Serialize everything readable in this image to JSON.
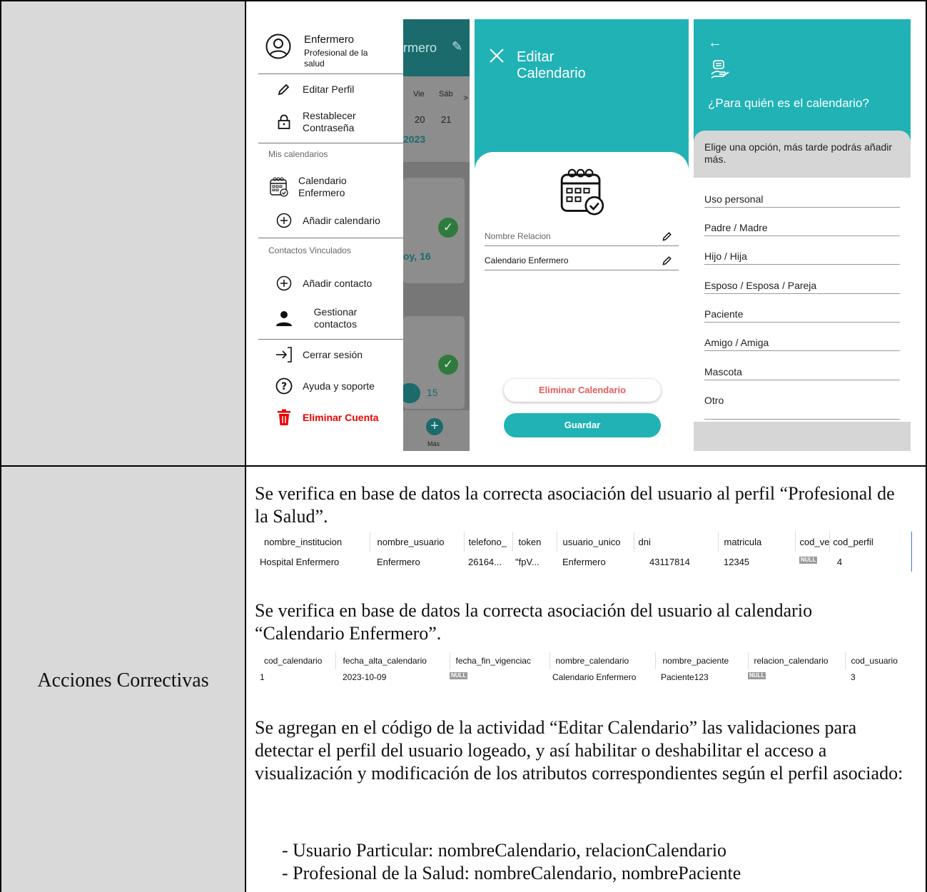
{
  "table": {
    "row2_label": "Acciones Correctivas"
  },
  "menu_screen": {
    "user_name": "Enfermero",
    "user_role": "Profesional de la salud",
    "items": {
      "edit_profile": "Editar Perfil",
      "reset_password": "Restablecer Contraseña",
      "my_calendars_section": "Mis calendarios",
      "calendar_item": "Calendario Enfermero",
      "add_calendar": "Añadir calendario",
      "contacts_section": "Contactos Vinculados",
      "add_contact": "Añadir contacto",
      "manage_contacts": "Gestionar contactos",
      "logout": "Cerrar sesión",
      "help": "Ayuda y soporte",
      "delete_account": "Eliminar Cuenta"
    },
    "background": {
      "title_fragment": "rmero",
      "day_vie": "Vie",
      "day_sab": "Sáb",
      "chevron": ">",
      "date_20": "20",
      "date_21": "21",
      "year": "2023",
      "today": "oy, 16",
      "num_15": "15",
      "mas": "Más"
    }
  },
  "edit_screen": {
    "title": "Editar Calendario",
    "field1_placeholder": "Nombre Relacion",
    "field2_value": "Calendario Enfermero",
    "delete_button": "Eliminar Calendario",
    "save_button": "Guardar",
    "colors": {
      "teal": "#20b2b5",
      "danger": "#e35d5b"
    }
  },
  "who_screen": {
    "question": "¿Para quién es el calendario?",
    "hint": "Elige una opción, más tarde podrás añadir más.",
    "options": [
      "Uso personal",
      "Padre / Madre",
      "Hijo / Hija",
      "Esposo / Esposa / Pareja",
      "Paciente",
      "Amigo / Amiga",
      "Mascota",
      "Otro"
    ]
  },
  "content": {
    "para1": "Se verifica en base de datos la correcta asociación del usuario al perfil “Profesional de la Salud”.",
    "db1": {
      "headers": [
        "nombre_institucion",
        "nombre_usuario",
        "telefono_",
        "token",
        "usuario_unico",
        "dni",
        "matricula",
        "cod_ve",
        "cod_perfil"
      ],
      "row": [
        "Hospital Enfermero",
        "Enfermero",
        "26164...",
        "\"fpV...",
        "Enfermero",
        "43117814",
        "12345",
        "NULL",
        "4"
      ]
    },
    "para2": "Se verifica en base de datos la correcta asociación del usuario al calendario “Calendario Enfermero”.",
    "db2": {
      "headers": [
        "cod_calendario",
        "fecha_alta_calendario",
        "fecha_fin_vigenciac",
        "nombre_calendario",
        "nombre_paciente",
        "relacion_calendario",
        "cod_usuario"
      ],
      "row": [
        "1",
        "2023-10-09",
        "NULL",
        "Calendario Enfermero",
        "Paciente123",
        "NULL",
        "3"
      ]
    },
    "para3": "Se agregan en el código de la actividad “Editar Calendario” las validaciones para detectar el perfil del usuario logeado, y así habilitar o deshabilitar el acceso a visualización y modificación de los atributos correspondientes según el perfil asociado:",
    "bullet1": "- Usuario Particular: nombreCalendario, relacionCalendario",
    "bullet2": "- Profesional de la Salud: nombreCalendario, nombrePaciente"
  }
}
